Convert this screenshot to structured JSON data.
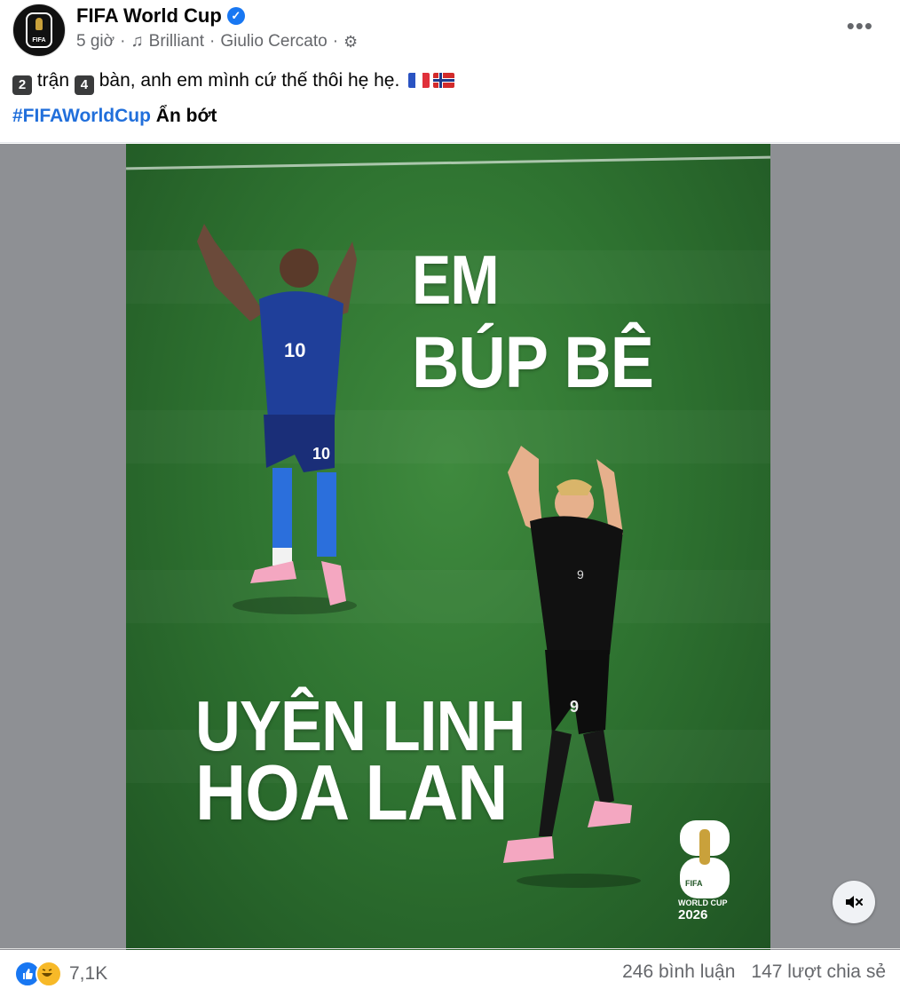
{
  "post": {
    "page_name": "FIFA World Cup",
    "time": "5 giờ",
    "music_track": "Brilliant",
    "music_artist": "Giulio Cercato",
    "separator": "·",
    "caption_n1": "2",
    "caption_w1": "trận",
    "caption_n2": "4",
    "caption_w2": "bàn, anh em mình cứ thế thôi hẹ hẹ.",
    "hashtag": "#FIFAWorldCup",
    "see_less": "Ẩn bớt",
    "more_label": "•••"
  },
  "poster": {
    "line1": "EM",
    "line2": "BÚP BÊ",
    "line3": "UYÊN LINH",
    "line4": "HOA LAN",
    "logo_fifa": "FIFA",
    "logo_text1": "WORLD CUP",
    "logo_text2": "2026",
    "colors": {
      "pitch": "#2f7431",
      "text": "#ffffff"
    }
  },
  "footer": {
    "reactions_count": "7,1K",
    "comments": "246 bình luận",
    "shares": "147 lượt chia sẻ"
  },
  "icons": [
    "verified-icon",
    "music-note-icon",
    "gear-icon",
    "more-options-icon",
    "like-reaction-icon",
    "haha-reaction-icon",
    "mute-icon"
  ],
  "colors": {
    "accent": "#1877f2",
    "hashtag": "#216fdb",
    "muted": "#65676b"
  }
}
